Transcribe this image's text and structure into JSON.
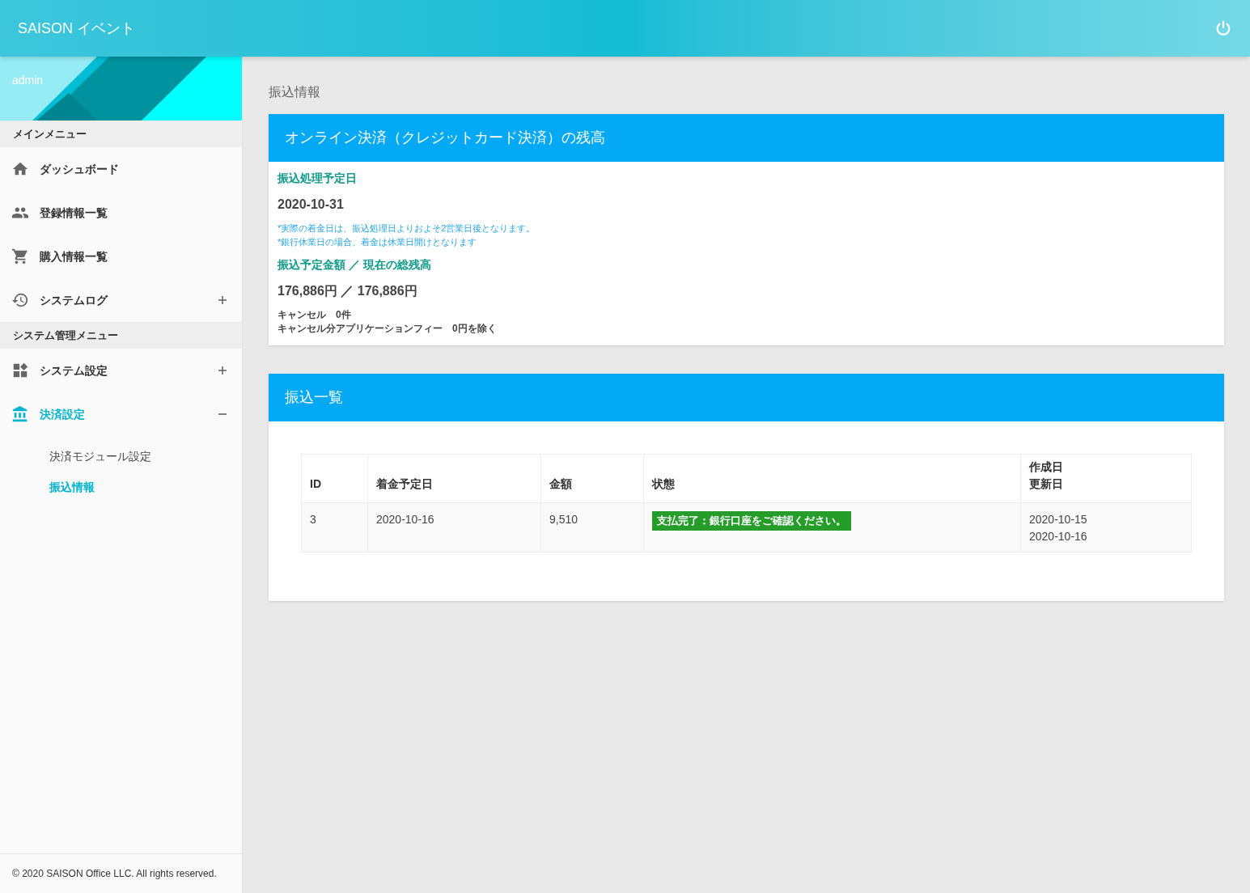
{
  "header": {
    "title": "SAISON イベント"
  },
  "sidebar": {
    "user": "admin",
    "sections": [
      {
        "title": "メインメニュー",
        "items": [
          {
            "label": "ダッシュボード",
            "selected": false
          },
          {
            "label": "登録情報一覧",
            "selected": false
          },
          {
            "label": "購入情報一覧",
            "selected": false
          },
          {
            "label": "システムログ",
            "selected": false,
            "expanded": false
          }
        ]
      },
      {
        "title": "システム管理メニュー",
        "items": [
          {
            "label": "システム設定",
            "selected": false,
            "expanded": false
          },
          {
            "label": "決済設定",
            "selected": true,
            "expanded": true,
            "children": [
              {
                "label": "決済モジュール設定",
                "selected": false
              },
              {
                "label": "振込情報",
                "selected": true
              }
            ]
          }
        ]
      }
    ],
    "footer": "© 2020 SAISON Office LLC. All rights reserved."
  },
  "page_title": "振込情報",
  "balance_card": {
    "title": "オンライン決済（クレジットカード決済）の残高",
    "date_label": "振込処理予定日",
    "date": "2020-10-31",
    "notes": [
      "*実際の着金日は、振込処理日よりおよそ2営業日後となります。",
      "*銀行休業日の場合、着金は休業日開けとなります"
    ],
    "amount_label": "振込予定金額 ／ 現在の総残高",
    "amount": "176,886円 ／ 176,886円",
    "details": [
      "キャンセル　0件",
      "キャンセル分アプリケーションフィー　0円を除く"
    ]
  },
  "transfer_card": {
    "title": "振込一覧",
    "table": {
      "columns": [
        [
          "ID"
        ],
        [
          "着金予定日"
        ],
        [
          "金額"
        ],
        [
          "状態"
        ],
        [
          "作成日",
          "更新日"
        ]
      ],
      "rows": [
        {
          "id": "3",
          "date": "2020-10-16",
          "amount": "9,510",
          "status": "支払完了：銀行口座をご確認ください。",
          "dates": [
            "2020-10-15",
            "2020-10-16"
          ]
        }
      ]
    }
  }
}
